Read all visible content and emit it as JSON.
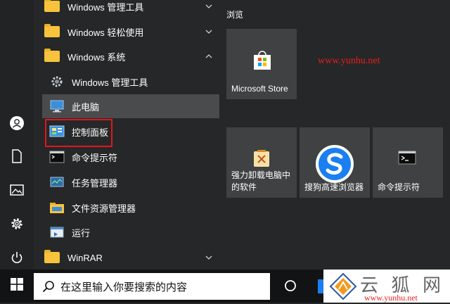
{
  "app_list": {
    "items": [
      {
        "label": "Windows 管理工具",
        "type": "folder",
        "chevron": "down",
        "icon": "folder-icon"
      },
      {
        "label": "Windows 轻松使用",
        "type": "folder",
        "chevron": "down",
        "icon": "folder-icon"
      },
      {
        "label": "Windows 系统",
        "type": "folder",
        "chevron": "up",
        "icon": "folder-icon"
      },
      {
        "label": "Windows 管理工具",
        "type": "sub",
        "icon": "admin-tools-icon"
      },
      {
        "label": "此电脑",
        "type": "sub",
        "icon": "this-pc-icon",
        "highlighted": true
      },
      {
        "label": "控制面板",
        "type": "sub",
        "icon": "control-panel-icon",
        "outlined": true
      },
      {
        "label": "命令提示符",
        "type": "sub",
        "icon": "cmd-icon"
      },
      {
        "label": "任务管理器",
        "type": "sub",
        "icon": "task-manager-icon"
      },
      {
        "label": "文件资源管理器",
        "type": "sub",
        "icon": "file-explorer-icon"
      },
      {
        "label": "运行",
        "type": "sub",
        "icon": "run-icon"
      },
      {
        "label": "WinRAR",
        "type": "folder",
        "chevron": "down",
        "icon": "folder-icon"
      }
    ]
  },
  "tiles": {
    "group_title": "浏览",
    "items": [
      {
        "label": "Microsoft Store",
        "icon": "store-icon"
      },
      {
        "label": "强力卸载电脑中的软件",
        "icon": "uninstall-icon"
      },
      {
        "label": "搜狗高速浏览器",
        "icon": "sogou-browser-icon"
      },
      {
        "label": "命令提示符",
        "icon": "cmd-icon"
      }
    ]
  },
  "watermark": {
    "top": "www.yunhu.net",
    "bottom_brand": "云 狐 网",
    "bottom_url": "www.yunhu.net"
  },
  "taskbar": {
    "search_placeholder": "在这里输入你要搜索的内容"
  },
  "colors": {
    "start_bg": "#262728",
    "tile_bg": "#3f4142",
    "highlight": "#4a4b4c",
    "outline_red": "#e0171d",
    "folder": "#f8c33c",
    "watermark_red": "#e81f1f"
  }
}
